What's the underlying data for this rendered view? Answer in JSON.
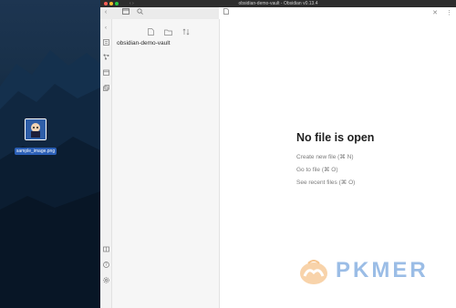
{
  "desktop": {
    "file_label": "sample_image.png"
  },
  "window": {
    "title": "obsidian-demo-vault - Obsidian v0.13.4",
    "traffic_colors": [
      "#ff5f57",
      "#febc2e",
      "#28c840"
    ]
  },
  "tabbar": {
    "close_glyph": "✕",
    "more_glyph": "⋮"
  },
  "sidebar": {
    "vault_name": "obsidian-demo-vault"
  },
  "main": {
    "empty_title": "No file is open",
    "links": [
      "Create new file (⌘ N)",
      "Go to file (⌘ O)",
      "See recent files (⌘ O)"
    ]
  },
  "watermark": {
    "text": "PKMER"
  },
  "icons": {
    "ribbon_top": [
      "folder-icon",
      "calendar-icon",
      "graph-icon",
      "templates-icon",
      "copy-icon"
    ],
    "ribbon_bottom": [
      "vault-icon",
      "help-icon",
      "settings-icon"
    ]
  }
}
